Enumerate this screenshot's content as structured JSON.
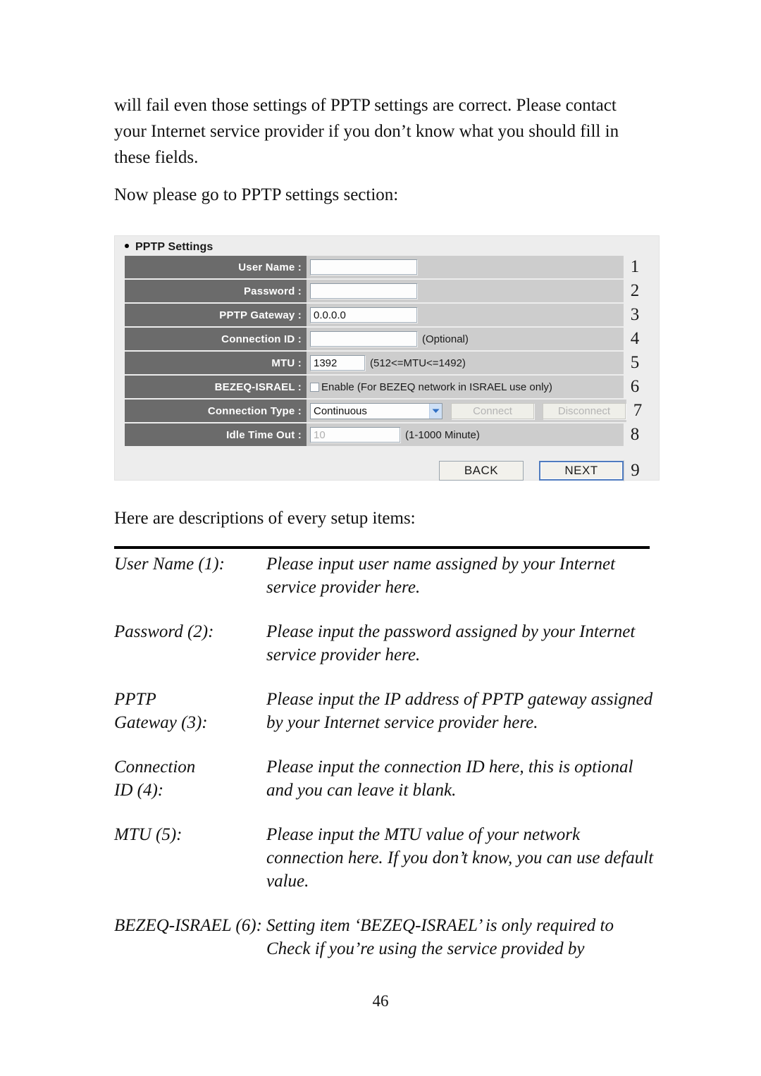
{
  "body_text": {
    "intro_paragraph": "will fail even those settings of PPTP settings are correct. Please contact your Internet service provider if you don’t know what you should fill in these fields.",
    "goto_line": "Now please go to PPTP settings section:",
    "descriptions_intro": "Here are descriptions of every setup items:"
  },
  "panel": {
    "heading": "PPTP Settings",
    "rows": [
      {
        "label": "User Name :",
        "control": "textbox",
        "value": "",
        "hint": "",
        "number": "1"
      },
      {
        "label": "Password :",
        "control": "textbox",
        "value": "",
        "hint": "",
        "number": "2"
      },
      {
        "label": "PPTP Gateway :",
        "control": "textbox",
        "value": "0.0.0.0",
        "hint": "",
        "number": "3"
      },
      {
        "label": "Connection ID :",
        "control": "textbox",
        "value": "",
        "hint": "(Optional)",
        "number": "4"
      },
      {
        "label": "MTU :",
        "control": "textbox-small",
        "value": "1392",
        "hint": "(512<=MTU<=1492)",
        "number": "5"
      },
      {
        "label": "BEZEQ-ISRAEL :",
        "control": "checkbox",
        "checkbox_label": "Enable (For BEZEQ network in ISRAEL use only)",
        "checked": false,
        "number": "6"
      },
      {
        "label": "Connection Type :",
        "control": "select",
        "value": "Continuous",
        "buttons": [
          "Connect",
          "Disconnect"
        ],
        "number": "7"
      },
      {
        "label": "Idle Time Out :",
        "control": "textbox-disabled",
        "value": "10",
        "hint": "(1-1000 Minute)",
        "number": "8"
      }
    ],
    "footer": {
      "back_label": "BACK",
      "next_label": "NEXT",
      "number": "9"
    },
    "colors": {
      "panel_background": "#ededed",
      "label_cell": "#6b6b6b",
      "value_cell": "#cdcdcd",
      "label_text": "#ffffff",
      "next_focus_ring": "#4f7bbf",
      "select_caret": "#2f6fc4"
    }
  },
  "descriptions": [
    {
      "term_line1": "User Name (1):",
      "term_line2": "",
      "definition": "Please input user name assigned by your Internet service provider here."
    },
    {
      "term_line1": "Password (2):",
      "term_line2": "",
      "definition": "Please input the password assigned by your Internet service provider here."
    },
    {
      "term_line1": "PPTP",
      "term_line2": "Gateway (3):",
      "definition": "Please input the IP address of PPTP gateway assigned by your Internet service provider here."
    },
    {
      "term_line1": "Connection",
      "term_line2": "ID (4):",
      "definition": "Please input the connection ID here, this is optional and you can leave it blank."
    },
    {
      "term_line1": "MTU (5):",
      "term_line2": "",
      "definition": "Please input the MTU value of your network connection here. If you don’t know, you can use default value."
    },
    {
      "term_line1": "BEZEQ-ISRAEL (6):",
      "term_line2": "",
      "definition": "Setting item ‘BEZEQ-ISRAEL’ is only required to Check if you’re using the service provided by"
    }
  ],
  "page_number": "46"
}
